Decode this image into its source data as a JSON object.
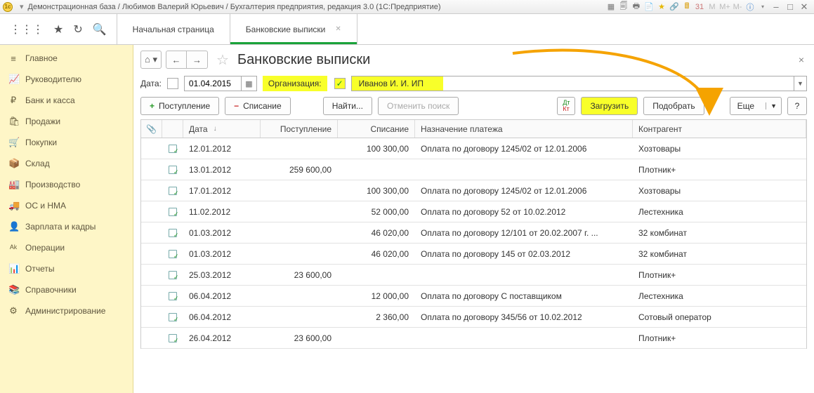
{
  "title": "Демонстрационная база / Любимов Валерий Юрьевич / Бухгалтерия предприятия, редакция 3.0  (1С:Предприятие)",
  "tabs": {
    "home": "Начальная страница",
    "active": "Банковские выписки"
  },
  "sidebar": {
    "items": [
      {
        "icon": "≡",
        "label": "Главное"
      },
      {
        "icon": "📈",
        "label": "Руководителю"
      },
      {
        "icon": "₽",
        "label": "Банк и касса"
      },
      {
        "icon": "🛍",
        "label": "Продажи"
      },
      {
        "icon": "🛒",
        "label": "Покупки"
      },
      {
        "icon": "📦",
        "label": "Склад"
      },
      {
        "icon": "🏭",
        "label": "Производство"
      },
      {
        "icon": "🚚",
        "label": "ОС и НМА"
      },
      {
        "icon": "👤",
        "label": "Зарплата и кадры"
      },
      {
        "icon": "ᴬᵏ",
        "label": "Операции"
      },
      {
        "icon": "📊",
        "label": "Отчеты"
      },
      {
        "icon": "📚",
        "label": "Справочники"
      },
      {
        "icon": "⚙",
        "label": "Администрирование"
      }
    ]
  },
  "page": {
    "title": "Банковские выписки",
    "date_label": "Дата:",
    "date_value": "01.04.2015",
    "org_label": "Организация:",
    "org_value": "Иванов И. И. ИП"
  },
  "toolbar": {
    "receipt": "Поступление",
    "writeoff": "Списание",
    "find": "Найти...",
    "cancel_find": "Отменить поиск",
    "load": "Загрузить",
    "pick": "Подобрать",
    "more": "Еще"
  },
  "columns": {
    "clip": "📎",
    "date": "Дата",
    "in": "Поступление",
    "out": "Списание",
    "purpose": "Назначение платежа",
    "contr": "Контрагент"
  },
  "rows": [
    {
      "date": "12.01.2012",
      "in": "",
      "out": "100 300,00",
      "purpose": "Оплата по договору 1245/02 от 12.01.2006",
      "contr": "Хозтовары"
    },
    {
      "date": "13.01.2012",
      "in": "259 600,00",
      "out": "",
      "purpose": "",
      "contr": "Плотник+"
    },
    {
      "date": "17.01.2012",
      "in": "",
      "out": "100 300,00",
      "purpose": "Оплата по договору 1245/02 от 12.01.2006",
      "contr": "Хозтовары"
    },
    {
      "date": "11.02.2012",
      "in": "",
      "out": "52 000,00",
      "purpose": "Оплата по договору 52 от 10.02.2012",
      "contr": "Лестехника"
    },
    {
      "date": "01.03.2012",
      "in": "",
      "out": "46 020,00",
      "purpose": "Оплата по договору 12/101 от 20.02.2007 г. ...",
      "contr": "32 комбинат"
    },
    {
      "date": "01.03.2012",
      "in": "",
      "out": "46 020,00",
      "purpose": "Оплата по договору 145 от 02.03.2012",
      "contr": "32 комбинат"
    },
    {
      "date": "25.03.2012",
      "in": "23 600,00",
      "out": "",
      "purpose": "",
      "contr": "Плотник+"
    },
    {
      "date": "06.04.2012",
      "in": "",
      "out": "12 000,00",
      "purpose": "Оплата по договору С поставщиком",
      "contr": "Лестехника"
    },
    {
      "date": "06.04.2012",
      "in": "",
      "out": "2 360,00",
      "purpose": "Оплата по договору 345/56 от 10.02.2012",
      "contr": "Сотовый оператор"
    },
    {
      "date": "26.04.2012",
      "in": "23 600,00",
      "out": "",
      "purpose": "",
      "contr": "Плотник+"
    }
  ]
}
